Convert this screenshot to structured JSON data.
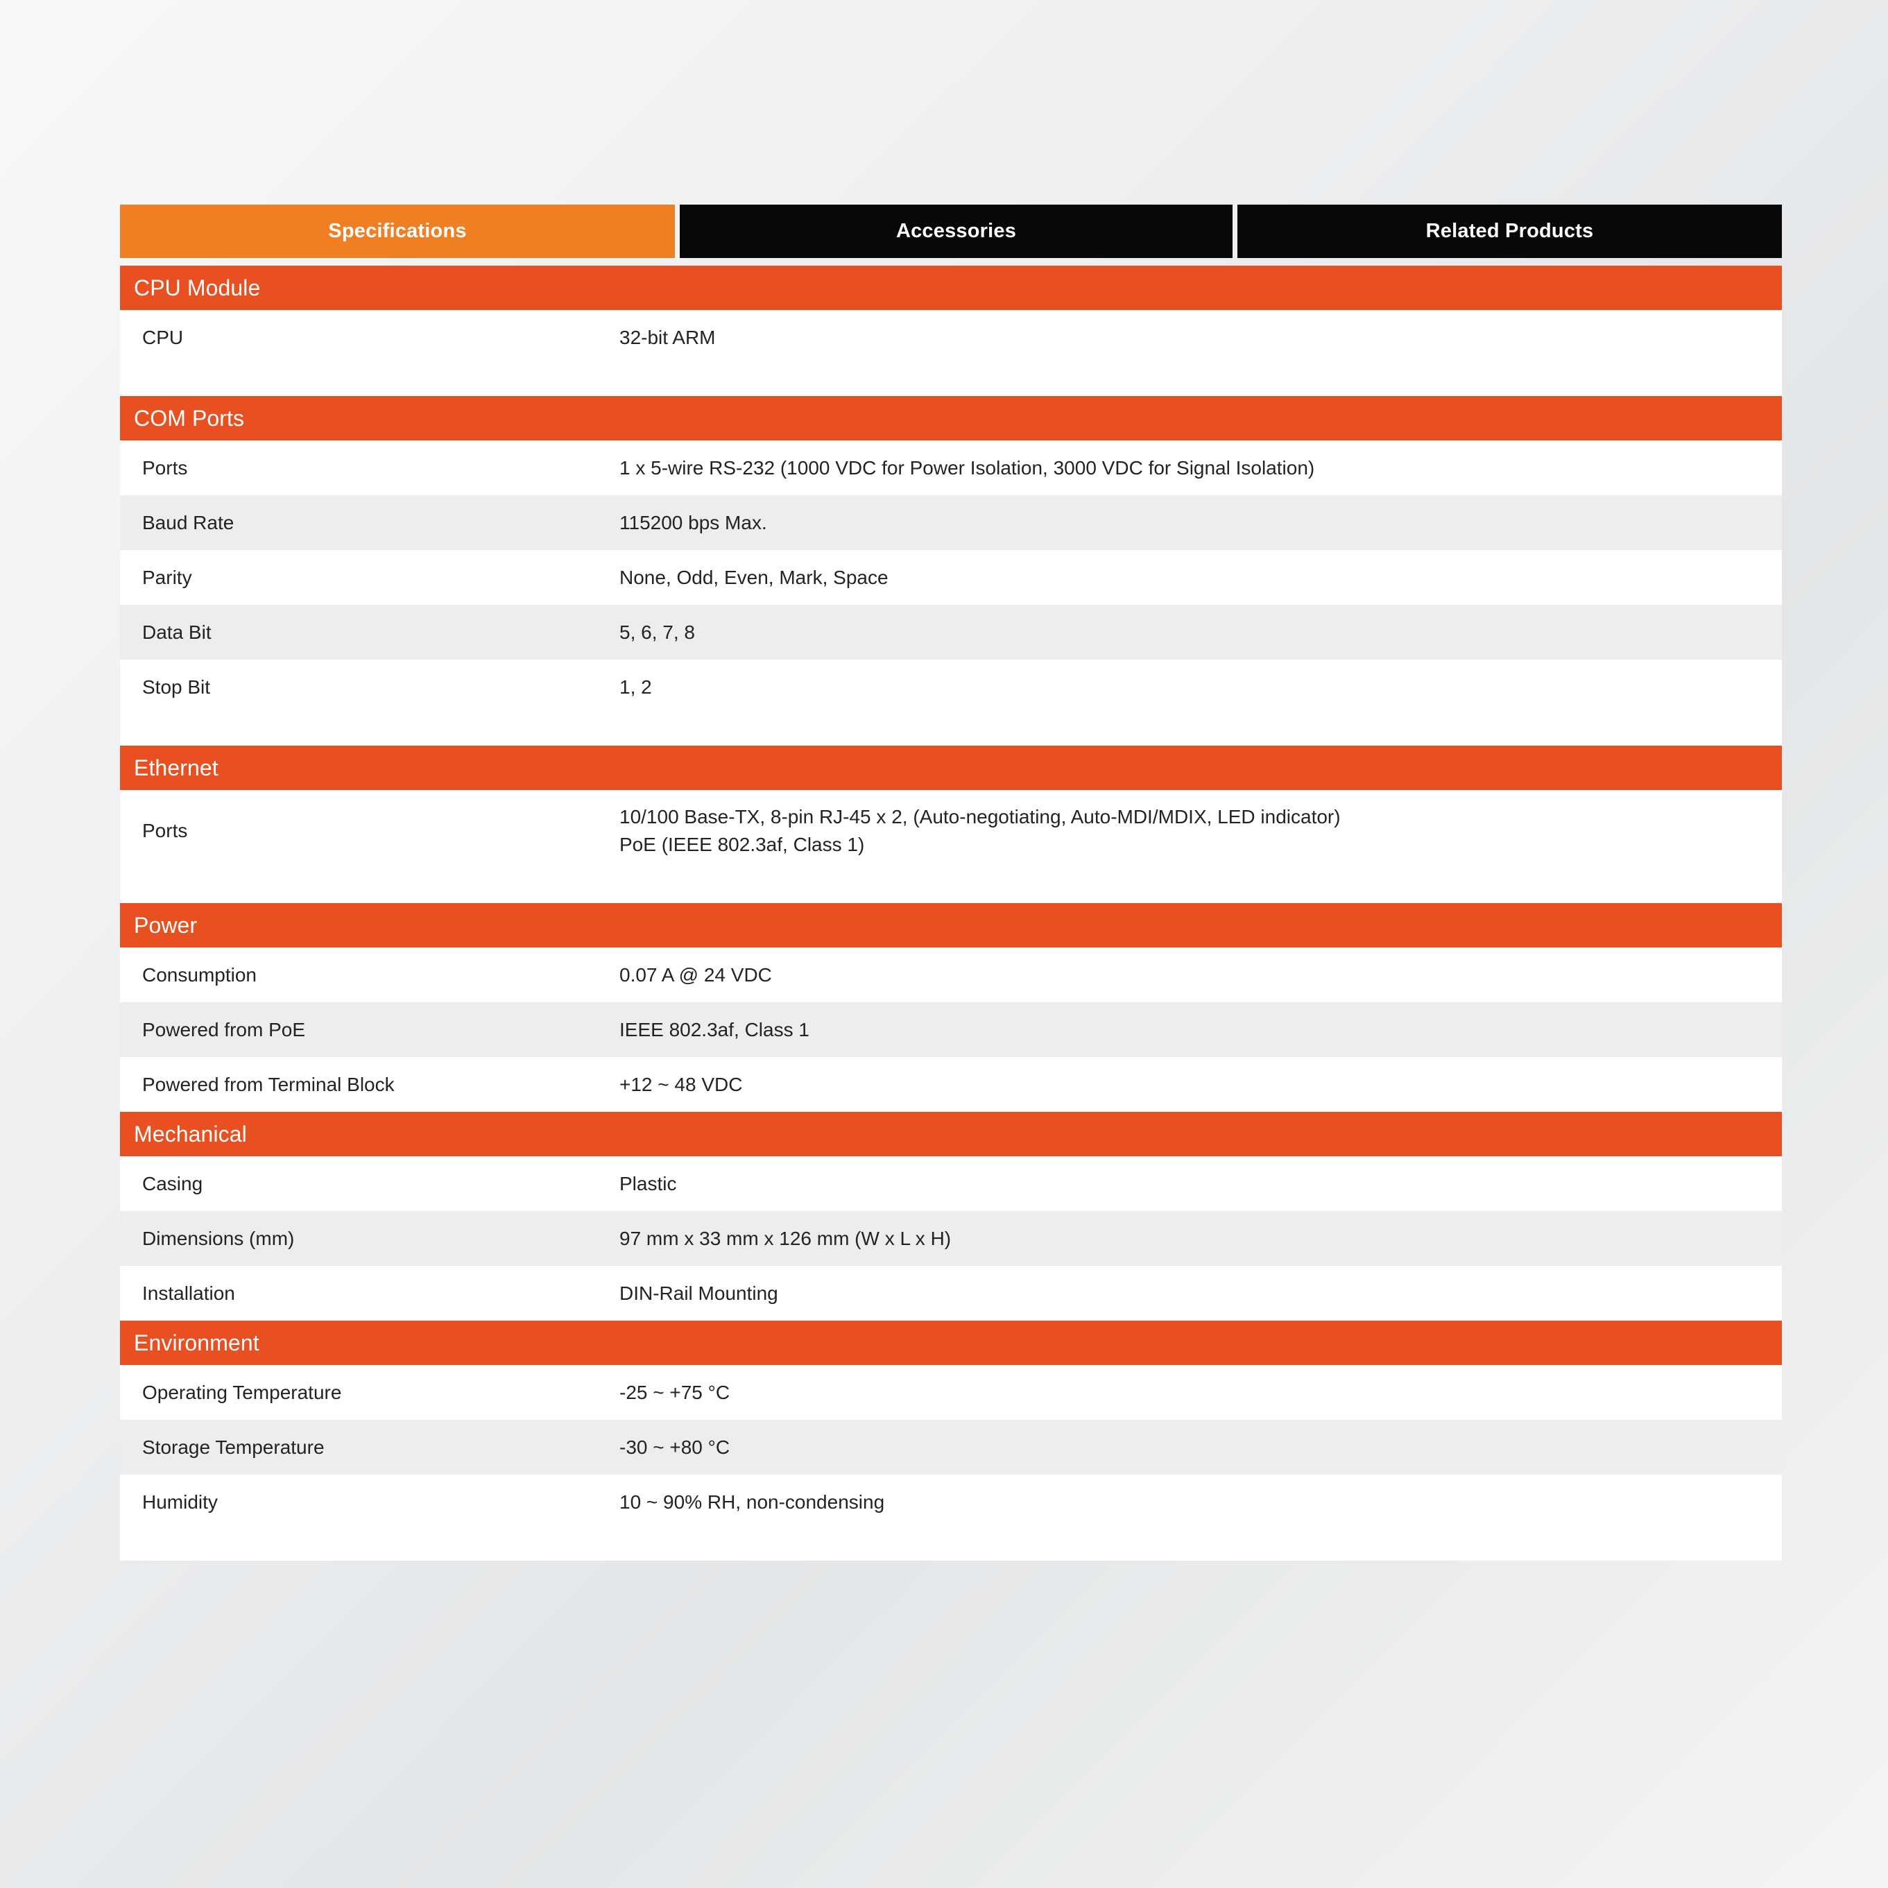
{
  "theme": {
    "tab_active_bg": "#ef7f22",
    "tab_inactive_bg": "#080808",
    "section_header_bg": "#e84f21",
    "row_bg": "#ffffff",
    "row_alt_bg": "#ededed",
    "text_color": "#222324"
  },
  "tabs": [
    {
      "label": "Specifications",
      "active": true
    },
    {
      "label": "Accessories",
      "active": false
    },
    {
      "label": "Related Products",
      "active": false
    }
  ],
  "sections": [
    {
      "title": "CPU Module",
      "trailing_pad": true,
      "rows": [
        {
          "label": "CPU",
          "value": "32-bit ARM"
        }
      ]
    },
    {
      "title": "COM Ports",
      "trailing_pad": true,
      "rows": [
        {
          "label": "Ports",
          "value": "1 x 5-wire RS-232 (1000 VDC for Power Isolation, 3000 VDC for Signal Isolation)"
        },
        {
          "label": "Baud Rate",
          "value": "115200 bps Max."
        },
        {
          "label": "Parity",
          "value": "None, Odd, Even, Mark, Space"
        },
        {
          "label": "Data Bit",
          "value": "5, 6, 7, 8"
        },
        {
          "label": "Stop Bit",
          "value": "1, 2"
        }
      ]
    },
    {
      "title": "Ethernet",
      "trailing_pad": true,
      "rows": [
        {
          "label": "Ports",
          "value": "10/100 Base-TX, 8-pin RJ-45 x 2, (Auto-negotiating, Auto-MDI/MDIX, LED indicator)\nPoE (IEEE 802.3af, Class 1)",
          "tall": true
        }
      ]
    },
    {
      "title": "Power",
      "trailing_pad": false,
      "rows": [
        {
          "label": "Consumption",
          "value": "0.07 A @ 24 VDC"
        },
        {
          "label": "Powered from PoE",
          "value": "IEEE 802.3af, Class 1"
        },
        {
          "label": "Powered from Terminal Block",
          "value": "+12 ~ 48 VDC"
        }
      ]
    },
    {
      "title": "Mechanical",
      "trailing_pad": false,
      "rows": [
        {
          "label": "Casing",
          "value": "Plastic"
        },
        {
          "label": "Dimensions (mm)",
          "value": "97 mm x 33 mm x 126 mm (W x L x H)"
        },
        {
          "label": "Installation",
          "value": "DIN-Rail Mounting"
        }
      ]
    },
    {
      "title": "Environment",
      "trailing_pad": true,
      "rows": [
        {
          "label": "Operating Temperature",
          "value": "-25 ~ +75 °C"
        },
        {
          "label": "Storage Temperature",
          "value": "-30 ~ +80 °C"
        },
        {
          "label": "Humidity",
          "value": "10 ~ 90% RH, non-condensing"
        }
      ]
    }
  ]
}
